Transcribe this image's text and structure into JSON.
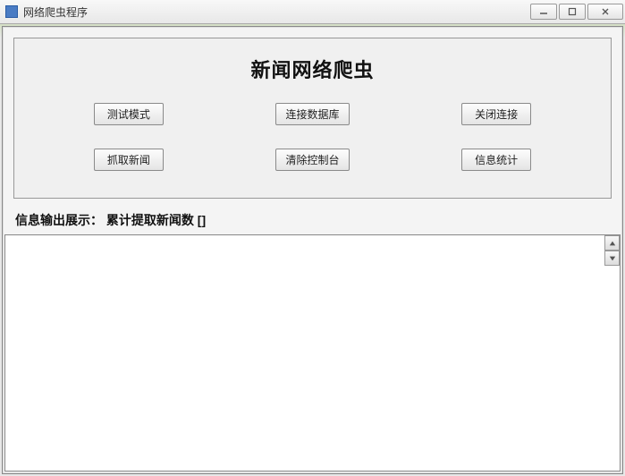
{
  "window": {
    "title": "网络爬虫程序"
  },
  "panel": {
    "heading": "新闻网络爬虫",
    "buttons": {
      "test_mode": "测试模式",
      "connect_db": "连接数据库",
      "close_conn": "关闭连接",
      "fetch_news": "抓取新闻",
      "clear_console": "清除控制台",
      "stats": "信息统计"
    }
  },
  "output": {
    "label_prefix": "信息输出展示：",
    "label_count": "累计提取新闻数",
    "count_value": "[]"
  }
}
